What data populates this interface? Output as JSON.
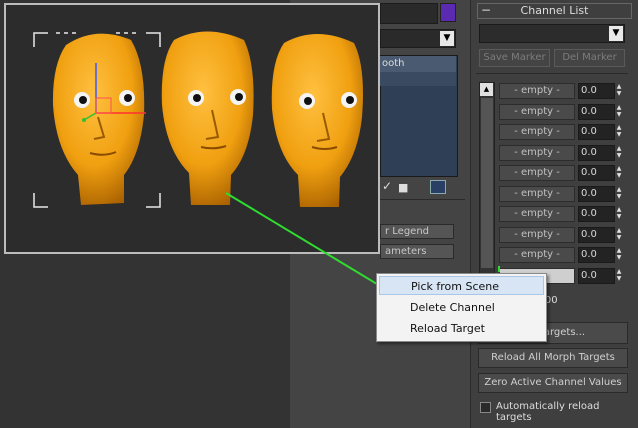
{
  "context_menu": {
    "items": [
      "Pick from Scene",
      "Delete Channel",
      "Reload Target"
    ]
  },
  "middle_panel": {
    "list_item_fragment": "ooth",
    "legend_fragment": "r Legend",
    "parameters_fragment": "ameters"
  },
  "channel_panel": {
    "collapse_symbol": "−",
    "title": "Channel List",
    "save_marker": "Save Marker",
    "delete_marker": "Del Marker",
    "range_text": "e :   91 - 100",
    "pick_targets_fragment": "ple Targets...",
    "reload_all": "Reload All Morph Targets",
    "zero_active": "Zero Active Channel Values",
    "auto_reload": "Automatically reload targets",
    "channels": [
      {
        "label": "- empty -",
        "value": "0.0"
      },
      {
        "label": "- empty -",
        "value": "0.0"
      },
      {
        "label": "- empty -",
        "value": "0.0"
      },
      {
        "label": "- empty -",
        "value": "0.0"
      },
      {
        "label": "- empty -",
        "value": "0.0"
      },
      {
        "label": "- empty -",
        "value": "0.0"
      },
      {
        "label": "- empty -",
        "value": "0.0"
      },
      {
        "label": "- empty -",
        "value": "0.0"
      },
      {
        "label": "- empty -",
        "value": "0.0"
      },
      {
        "label": "",
        "value": "0.0"
      }
    ]
  },
  "colors": {
    "head_orange": "#f0a010",
    "guide_line": "#2fdc2f",
    "purple_swatch": "#5a2ab0"
  }
}
